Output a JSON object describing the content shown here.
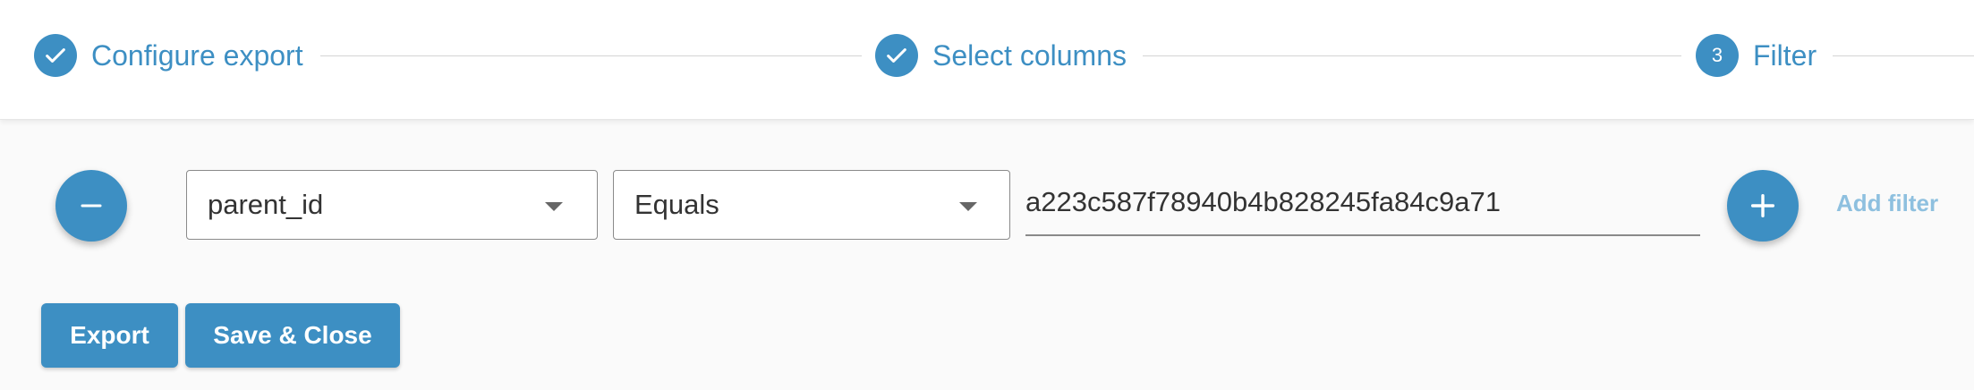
{
  "stepper": {
    "steps": [
      {
        "label": "Configure export",
        "state": "completed",
        "icon": "check-icon"
      },
      {
        "label": "Select columns",
        "state": "completed",
        "icon": "check-icon"
      },
      {
        "label": "Filter",
        "state": "active",
        "number": "3"
      }
    ]
  },
  "filter": {
    "remove_icon": "minus-icon",
    "field": {
      "value": "parent_id",
      "icon": "caret-down-icon"
    },
    "operator": {
      "value": "Equals",
      "icon": "caret-down-icon"
    },
    "value": "a223c587f78940b4b828245fa84c9a71",
    "add_icon": "plus-icon",
    "add_label": "Add filter"
  },
  "actions": {
    "export_label": "Export",
    "save_close_label": "Save & Close"
  },
  "colors": {
    "accent": "#3d8fc3",
    "link_muted": "#8ec0df",
    "divider": "#d4d4d4"
  }
}
